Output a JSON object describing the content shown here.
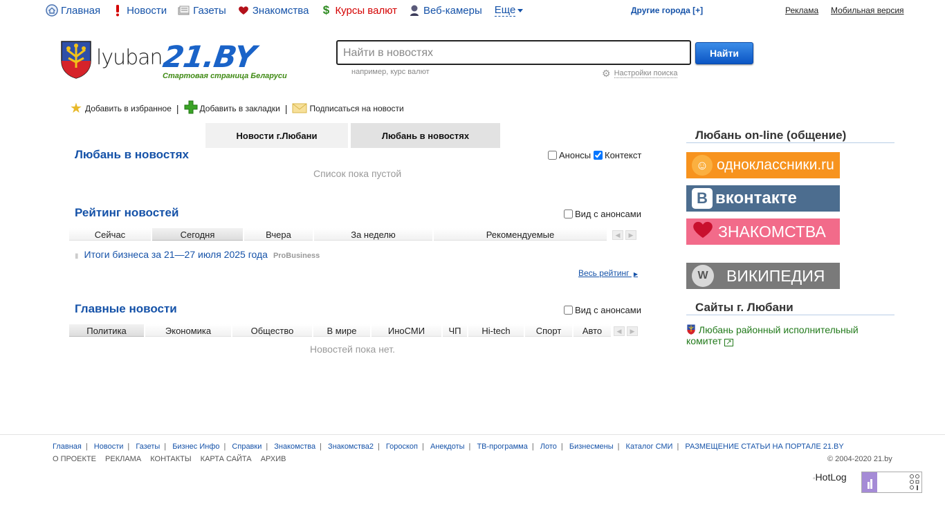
{
  "topnav": {
    "items": [
      {
        "label": "Главная",
        "icon": "home-icon"
      },
      {
        "label": "Новости",
        "icon": "exclamation-icon"
      },
      {
        "label": "Газеты",
        "icon": "newspaper-icon"
      },
      {
        "label": "Знакомства",
        "icon": "heart-icon"
      },
      {
        "label": "Курсы валют",
        "icon": "dollar-icon"
      },
      {
        "label": "Веб-камеры",
        "icon": "webcam-icon"
      }
    ],
    "more": "Еще",
    "other_cities": "Другие города [+]",
    "ads": "Реклама",
    "mobile": "Мобильная версия"
  },
  "logo": {
    "city": "lyuban.",
    "brand": "21.BY",
    "slogan": "Стартовая страница Беларуси"
  },
  "search": {
    "placeholder": "Найти в новостях",
    "button": "Найти",
    "hint": "например, курс валют",
    "settings": "Настройки поиска"
  },
  "favs": {
    "favorites": "Добавить в избранное",
    "bookmarks": "Добавить в закладки",
    "subscribe": "Подписаться на новости"
  },
  "tabs": [
    "Новости г.Любани",
    "Любань в новостях"
  ],
  "context_section": {
    "title": "Любань в новостях",
    "announcements": "Анонсы",
    "context": "Контекст",
    "empty": "Список пока пустой"
  },
  "rating": {
    "title": "Рейтинг новостей",
    "with_announcements": "Вид с анонсами",
    "tabs": [
      "Сейчас",
      "Сегодня",
      "Вчера",
      "За неделю",
      "Рекомендуемые"
    ],
    "item": {
      "title": "Итоги бизнеса за 21—27 июля 2025 года",
      "source": "ProBusiness"
    },
    "all": "Весь рейтинг"
  },
  "main_news": {
    "title": "Главные новости",
    "with_announcements": "Вид с анонсами",
    "tabs": [
      "Политика",
      "Экономика",
      "Общество",
      "В мире",
      "ИноСМИ",
      "ЧП",
      "Hi-tech",
      "Спорт",
      "Авто"
    ],
    "empty": "Новостей пока нет."
  },
  "right": {
    "online_title": "Любань on-line (общение)",
    "banners": [
      {
        "label": "одноклассники.ru",
        "color": "#f7931e"
      },
      {
        "label": "вконтакте",
        "color": "#4c6d8f"
      },
      {
        "label": "ЗНАКОМСТВА",
        "color": "#f26b8a"
      },
      {
        "label": "ВИКИПЕДИЯ",
        "color": "#7a7a7a"
      }
    ],
    "sites_title": "Сайты г. Любани",
    "site_link": "Любань районный исполнительный комитет"
  },
  "footer": {
    "links": [
      "Главная",
      "Новости",
      "Газеты",
      "Бизнес Инфо",
      "Справки",
      "Знакомства",
      "Знакомства2",
      "Гороскоп",
      "Анекдоты",
      "ТВ-программа",
      "Лото",
      "Бизнесмены",
      "Каталог СМИ",
      "РАЗМЕЩЕНИЕ СТАТЬИ НА ПОРТАЛЕ 21.BY"
    ],
    "links2": [
      "О ПРОЕКТЕ",
      "РЕКЛАМА",
      "КОНТАКТЫ",
      "КАРТА САЙТА",
      "АРХИВ"
    ],
    "copyright": "© 2004-2020 21.by",
    "hotlog": "HotLog"
  }
}
